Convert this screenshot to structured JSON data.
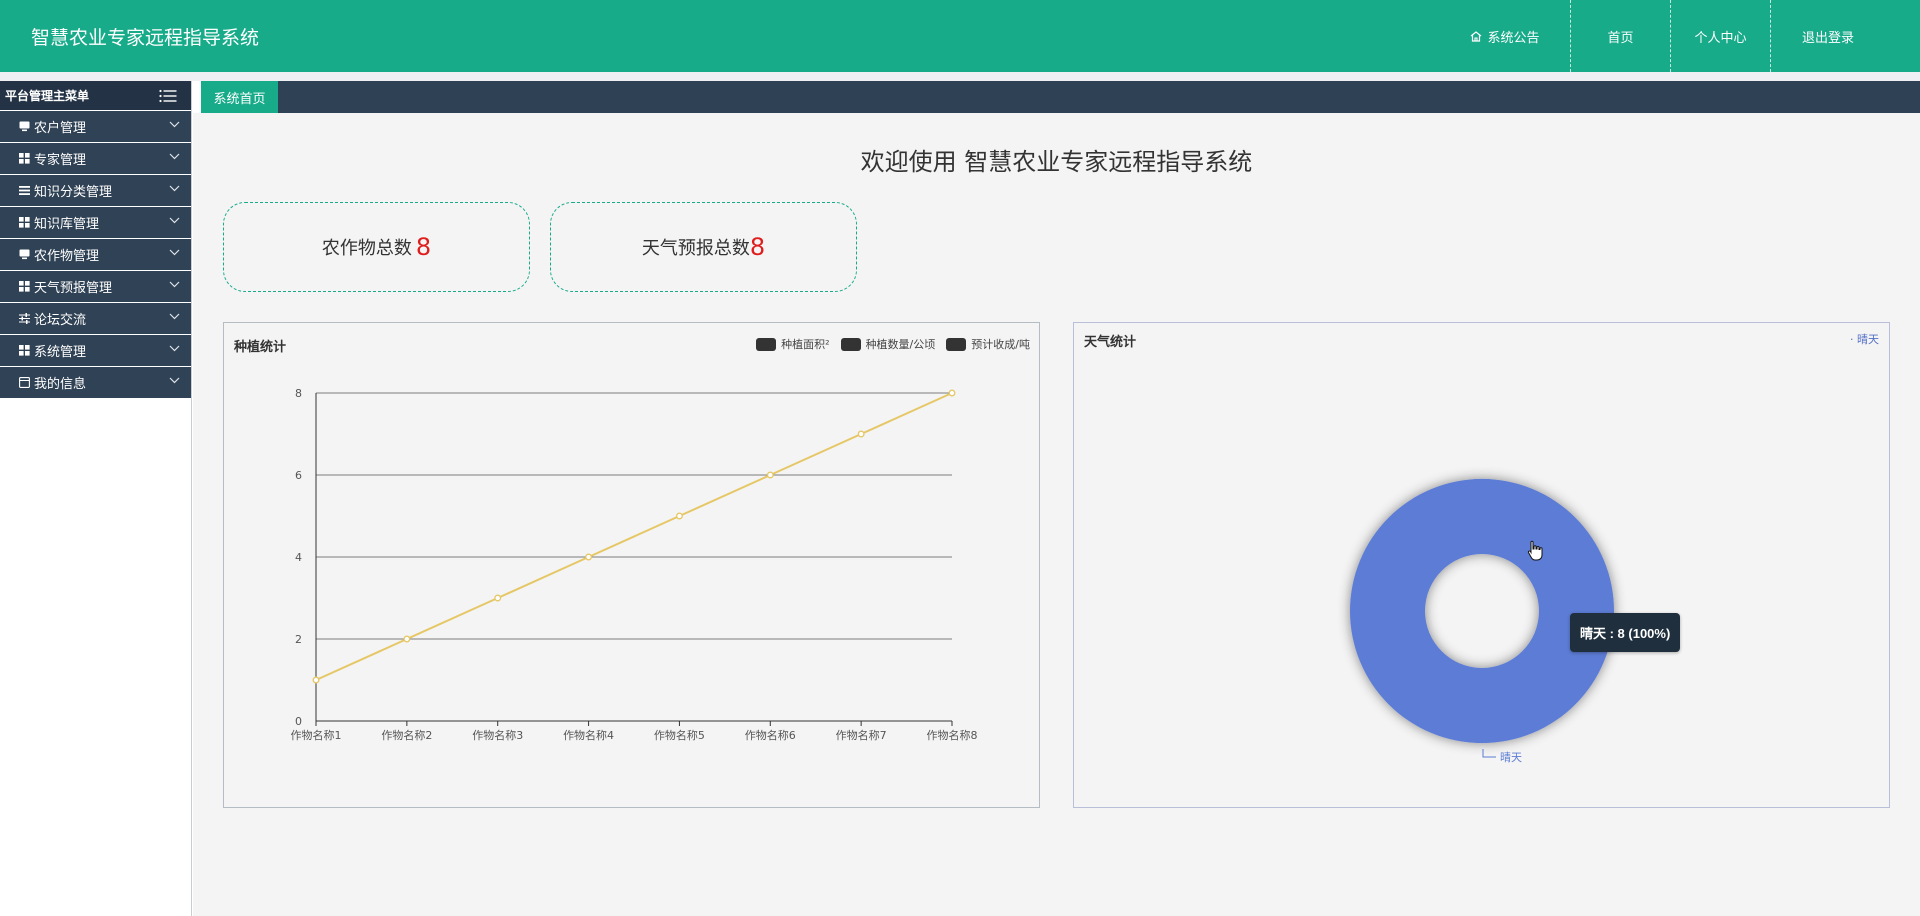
{
  "header": {
    "title": "智慧农业专家远程指导系统",
    "nav": {
      "notice": "系统公告",
      "home": "首页",
      "profile": "个人中心",
      "logout": "退出登录"
    }
  },
  "sidebar": {
    "heading": "平台管理主菜单",
    "items": [
      {
        "label": "农户管理",
        "icon": "monitor-icon"
      },
      {
        "label": "专家管理",
        "icon": "grid-icon"
      },
      {
        "label": "知识分类管理",
        "icon": "list-icon"
      },
      {
        "label": "知识库管理",
        "icon": "grid-icon"
      },
      {
        "label": "农作物管理",
        "icon": "monitor-icon"
      },
      {
        "label": "天气预报管理",
        "icon": "grid-icon"
      },
      {
        "label": "论坛交流",
        "icon": "sliders-icon"
      },
      {
        "label": "系统管理",
        "icon": "grid-icon"
      },
      {
        "label": "我的信息",
        "icon": "window-icon"
      }
    ]
  },
  "tabs": [
    {
      "label": "系统首页"
    }
  ],
  "main": {
    "welcome": "欢迎使用 智慧农业专家远程指导系统",
    "stats": {
      "crops_label": "农作物总数",
      "crops_value": "8",
      "weather_label": "天气预报总数",
      "weather_value": "8"
    }
  },
  "colors": {
    "brand": "#18ab8a",
    "sidebar": "#304255",
    "line": "#e6c766",
    "pie": "#5b7bd5",
    "stat_number": "#e01d1d"
  },
  "chart_data": [
    {
      "type": "line",
      "title": "种植统计",
      "legend": [
        "种植面积²",
        "种植数量/公顷",
        "预计收成/吨"
      ],
      "categories": [
        "作物名称1",
        "作物名称2",
        "作物名称3",
        "作物名称4",
        "作物名称5",
        "作物名称6",
        "作物名称7",
        "作物名称8"
      ],
      "series": [
        {
          "values": [
            1,
            2,
            3,
            4,
            5,
            6,
            7,
            8
          ]
        }
      ],
      "ylim": [
        0,
        8
      ],
      "yticks": [
        0,
        2,
        4,
        6,
        8
      ],
      "grid": true,
      "legend_position": "top-right"
    },
    {
      "type": "pie",
      "title": "天气统计",
      "slices": [
        {
          "label": "晴天",
          "value": 8,
          "percent": 100
        }
      ],
      "legend": [
        "晴天"
      ],
      "legend_position": "top-right",
      "tooltip": "晴天 : 8 (100%)"
    }
  ]
}
